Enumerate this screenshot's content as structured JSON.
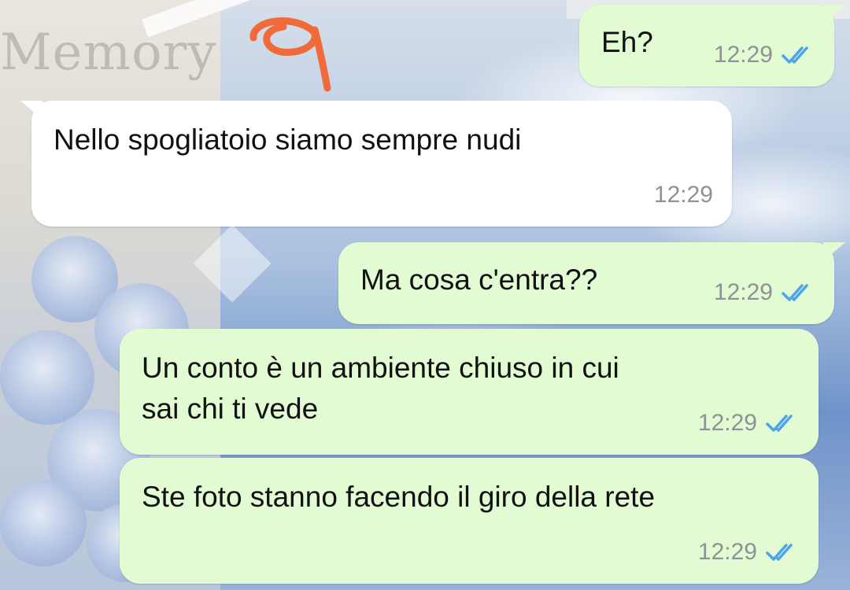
{
  "wallpaper": {
    "left_text": "Memory",
    "scribble_color": "#f06a3a"
  },
  "messages": [
    {
      "direction": "out",
      "text": "Eh?",
      "time": "12:29",
      "status": "read"
    },
    {
      "direction": "in",
      "text": "Nello spogliatoio siamo sempre nudi",
      "time": "12:29"
    },
    {
      "direction": "out",
      "text": "Ma cosa c'entra??",
      "time": "12:29",
      "status": "read"
    },
    {
      "direction": "out",
      "text": "Un conto è un ambiente chiuso in cui sai chi ti vede",
      "time": "12:29",
      "status": "read"
    },
    {
      "direction": "out",
      "text": "Ste foto stanno facendo il giro della rete",
      "time": "12:29",
      "status": "read"
    }
  ],
  "colors": {
    "outgoing_bubble": "#e3fbd2",
    "incoming_bubble": "#ffffff",
    "read_ticks": "#4fa3e8",
    "timestamp": "#8e9196"
  },
  "icons": {
    "read_receipt": "double-check-icon"
  }
}
